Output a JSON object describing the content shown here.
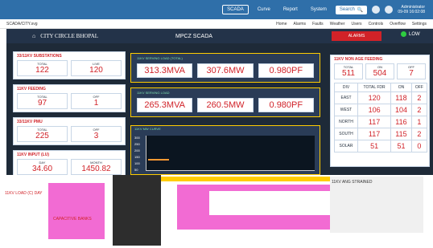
{
  "topbar": {
    "nav": [
      "SCADA",
      "Curve",
      "Report",
      "System"
    ],
    "active": "SCADA",
    "search_label": "Search",
    "user_line1": "Administrator",
    "user_line2": "09-09 16:02:08"
  },
  "subbar": {
    "left": "SCADA/CITY.svg",
    "links": [
      "Home",
      "Alarms",
      "Faults",
      "Weather",
      "Users",
      "Controls",
      "Overflow",
      "Settings"
    ]
  },
  "header": {
    "city": "CITY CIRCLE BHOPAL",
    "title": "MPCZ SCADA",
    "alarm_text": "ALARMS",
    "status": "LOW"
  },
  "left": {
    "substations": {
      "title": "33/11KV SUBSTATIONS",
      "total_label": "TOTAL",
      "total": "122",
      "live_label": "LIVE",
      "live": "120"
    },
    "feeding": {
      "title": "11KV FEEDING",
      "total_label": "TOTAL",
      "total": "97",
      "off_label": "OFF",
      "off": "1"
    },
    "pmt": {
      "title": "33/11KV PMU",
      "total_label": "TOTAL",
      "total": "225",
      "off_label": "OFF",
      "off": "3"
    },
    "input": {
      "title": "11KV INPUT (LU)",
      "day_label": "DAY",
      "day": "34.60",
      "month_label": "MONTH",
      "month": "1450.82"
    }
  },
  "middle": {
    "panel1": {
      "title": "11KV SERVING LOAD (TOTAL)",
      "v1": "313.3MVA",
      "v2": "307.6MW",
      "v3": "0.980PF"
    },
    "panel2": {
      "title": "11KV SERVING LOAD",
      "v1": "265.3MVA",
      "v2": "260.5MW",
      "v3": "0.980PF"
    },
    "graph": {
      "title": "11KV MW CURVE",
      "yticks": [
        "300",
        "250",
        "200",
        "150",
        "100",
        "50"
      ]
    }
  },
  "right": {
    "title": "11KV NON AGE FEEDING",
    "total_label": "TOTAL",
    "total": "511",
    "on_label": "ON",
    "on": "504",
    "off_label": "OFF",
    "off": "7",
    "columns": [
      "DIV",
      "TOTAL FDR",
      "ON",
      "OFF"
    ],
    "rows": [
      [
        "EAST",
        "120",
        "118",
        "2"
      ],
      [
        "WEST",
        "106",
        "104",
        "2"
      ],
      [
        "NORTH",
        "117",
        "116",
        "1"
      ],
      [
        "SOUTH",
        "117",
        "115",
        "2"
      ],
      [
        "SOLAR",
        "51",
        "51",
        "0"
      ]
    ]
  },
  "bottom": {
    "label1": "11KV LOAD (C) DAY",
    "label2": "CAPACITIVE BANKS",
    "rightlabel": "11KV ANG STRAINED"
  },
  "colors": {
    "accent": "#d12228",
    "panel_border": "#ffcc00",
    "topbar": "#2f6fa9"
  }
}
